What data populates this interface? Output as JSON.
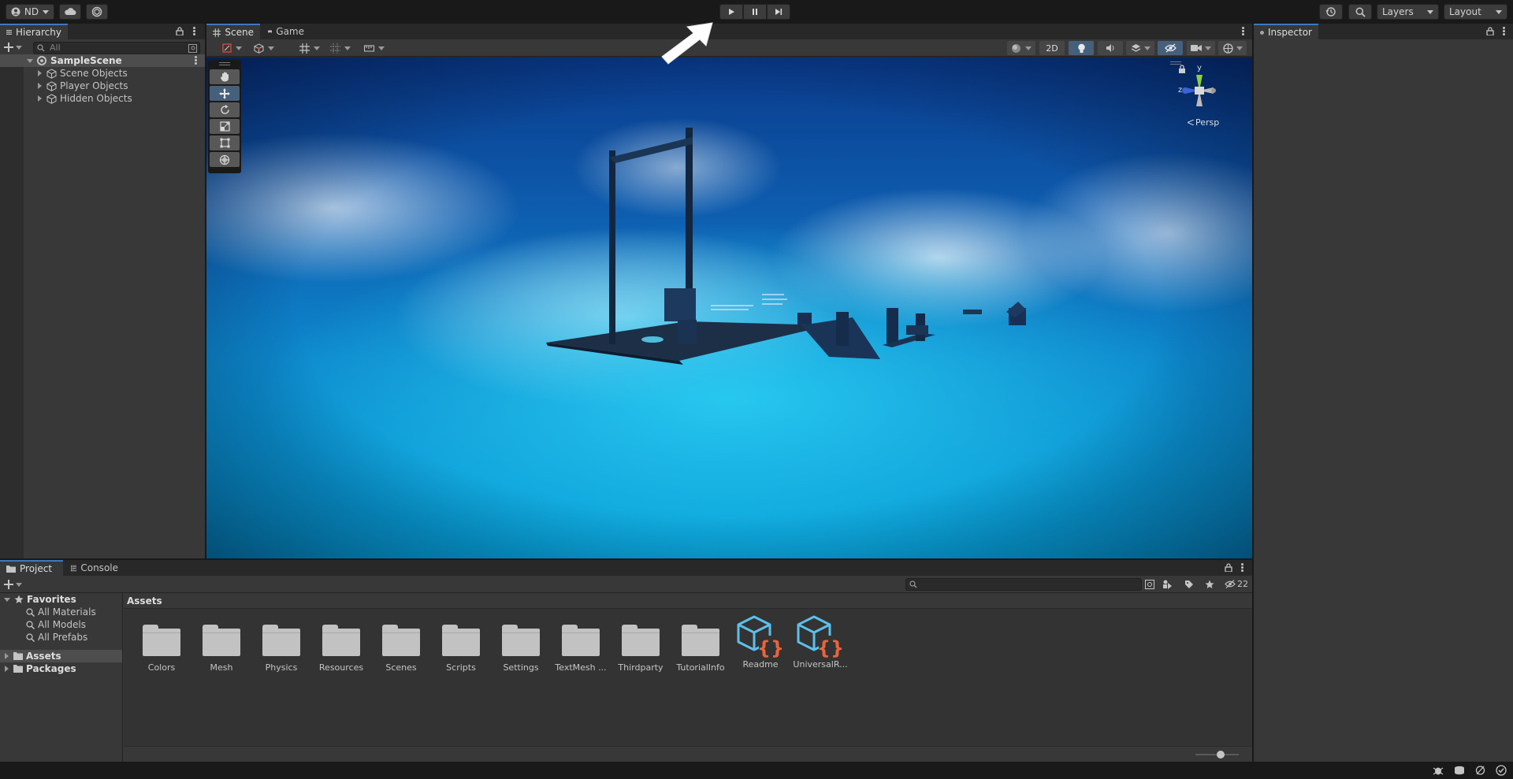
{
  "toolbar": {
    "account_label": "ND",
    "layers_label": "Layers",
    "layout_label": "Layout"
  },
  "hierarchy": {
    "tab_label": "Hierarchy",
    "search_placeholder": "All",
    "scene_name": "SampleScene",
    "items": [
      {
        "label": "Scene Objects"
      },
      {
        "label": "Player Objects"
      },
      {
        "label": "Hidden Objects"
      }
    ]
  },
  "scene": {
    "tabs": [
      {
        "label": "Scene"
      },
      {
        "label": "Game"
      }
    ],
    "toggle_2d": "2D",
    "gizmo": {
      "axis_y": "y",
      "axis_z": "z",
      "projection": "Persp"
    }
  },
  "inspector": {
    "tab_label": "Inspector"
  },
  "project": {
    "tabs": [
      {
        "label": "Project"
      },
      {
        "label": "Console"
      }
    ],
    "hidden_count": "22",
    "favorites_label": "Favorites",
    "favorites": [
      {
        "label": "All Materials"
      },
      {
        "label": "All Models"
      },
      {
        "label": "All Prefabs"
      }
    ],
    "tree": [
      {
        "label": "Assets"
      },
      {
        "label": "Packages"
      }
    ],
    "breadcrumb": "Assets",
    "assets": [
      {
        "label": "Colors",
        "kind": "folder"
      },
      {
        "label": "Mesh",
        "kind": "folder"
      },
      {
        "label": "Physics",
        "kind": "folder"
      },
      {
        "label": "Resources",
        "kind": "folder"
      },
      {
        "label": "Scenes",
        "kind": "folder"
      },
      {
        "label": "Scripts",
        "kind": "folder"
      },
      {
        "label": "Settings",
        "kind": "folder"
      },
      {
        "label": "TextMesh ...",
        "kind": "folder"
      },
      {
        "label": "Thirdparty",
        "kind": "folder"
      },
      {
        "label": "TutorialInfo",
        "kind": "folder"
      },
      {
        "label": "Readme",
        "kind": "script-asset"
      },
      {
        "label": "UniversalR...",
        "kind": "script-asset"
      }
    ]
  },
  "colors": {
    "accent": "#3a79bb",
    "selected": "#46607c",
    "asset_cube": "#5bc0eb",
    "asset_braces": "#e8643c"
  }
}
